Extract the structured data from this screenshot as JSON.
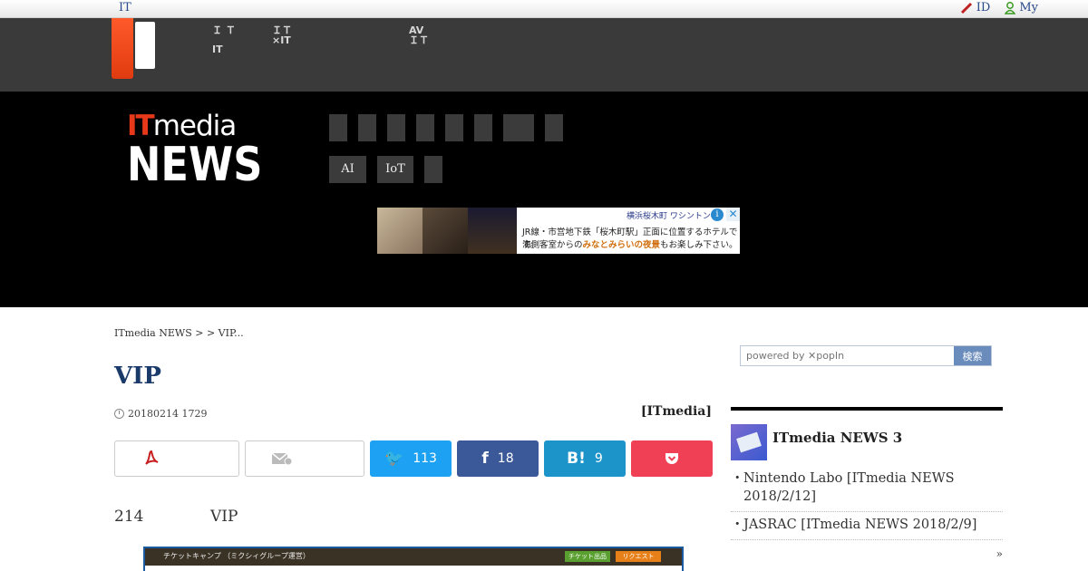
{
  "topbar": {
    "brand": "IT",
    "id_label": "ID",
    "my_label": "My"
  },
  "catbar": {
    "items": [
      {
        "line1": "Ｉ Ｔ",
        "line2": "IT"
      },
      {
        "line1": "ＩＴ",
        "line2": "×IT"
      },
      {
        "line1": "AV",
        "line2": "ＩＴ"
      }
    ]
  },
  "header": {
    "logo_it": "IT",
    "logo_media": "media",
    "logo_news": "NEWS",
    "tags": [
      "AI",
      "IoT",
      ""
    ]
  },
  "ad": {
    "line1": "横浜桜木町 ワシントン",
    "line2": "JR線・市営地下鉄「桜木町駅」正面に位置するホテルです。",
    "line3a": "海側客室からの",
    "line3b": "みなとみらいの夜景",
    "line3c": "もお楽しみ下さい。"
  },
  "article": {
    "breadcrumb": "ITmedia NEWS >  > VIP...",
    "title": "VIP",
    "date": "20180214 1729",
    "byline": "[ITmedia]",
    "lead_a": "214",
    "lead_b": "VIP"
  },
  "share": {
    "twitter_count": "113",
    "facebook_count": "18",
    "hatena_count": "9"
  },
  "embedded_screenshot": {
    "title": "チケットキャンプ （ミクシィグループ運営）",
    "btn1": "チケット出品",
    "btn2": "リクエスト"
  },
  "sidebar": {
    "search_placeholder": "powered by ✕popIn",
    "search_button": "検索",
    "ranking_title": "ITmedia NEWS 3",
    "items": [
      "Nintendo Labo [ITmedia NEWS 2018/2/12]",
      "JASRAC [ITmedia NEWS 2018/2/9]"
    ],
    "more": "»"
  },
  "colors": {
    "accent": "#e8381a",
    "title_blue": "#1a3a6a",
    "twitter": "#1da1f2",
    "facebook": "#3b5998",
    "hatena": "#1c93c9",
    "pocket": "#ef4056"
  }
}
